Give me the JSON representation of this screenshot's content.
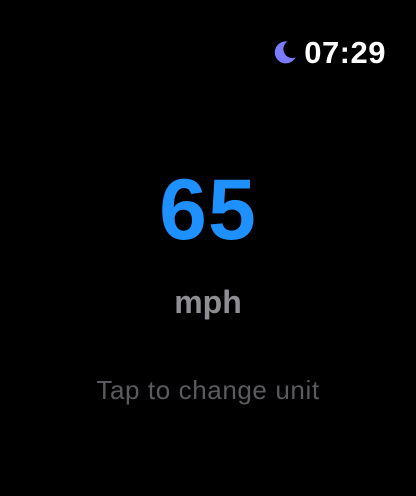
{
  "status_bar": {
    "time": "07:29",
    "focus_icon": "moon-icon",
    "focus_icon_color": "#7b7bff"
  },
  "speed": {
    "value": "65",
    "unit": "mph",
    "value_color": "#1e90ff",
    "unit_color": "#8e8e93"
  },
  "hint": {
    "text": "Tap to change unit",
    "color": "#5a5a5f"
  },
  "colors": {
    "background": "#000000"
  }
}
